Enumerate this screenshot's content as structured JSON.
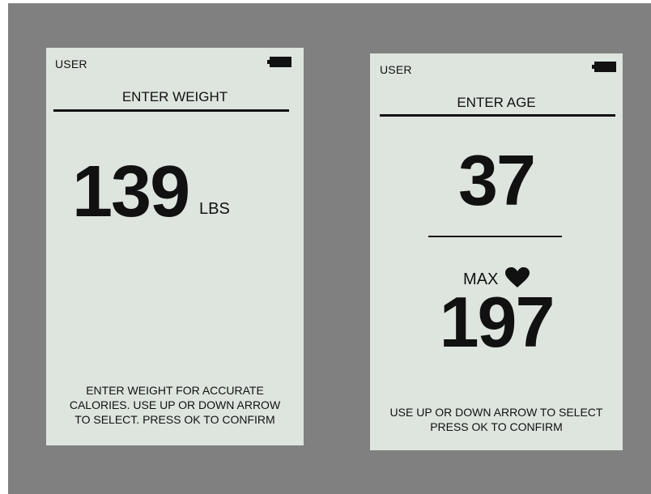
{
  "colors": {
    "background": "#808080",
    "screen": "#dde5de",
    "text": "#111111"
  },
  "weight_screen": {
    "user_label": "USER",
    "battery_icon": "battery-full-icon",
    "title": "ENTER WEIGHT",
    "value": "139",
    "unit": "LBS",
    "instructions": [
      "ENTER WEIGHT FOR ACCURATE",
      "CALORIES.  USE UP OR DOWN ARROW",
      "TO SELECT. PRESS OK TO CONFIRM"
    ]
  },
  "age_screen": {
    "user_label": "USER",
    "battery_icon": "battery-full-icon",
    "title": "ENTER AGE",
    "value": "37",
    "max_label": "MAX",
    "heart_icon": "heart-icon",
    "max_heart_rate": "197",
    "instructions": [
      "USE UP OR DOWN ARROW TO SELECT",
      "PRESS OK TO CONFIRM"
    ]
  }
}
